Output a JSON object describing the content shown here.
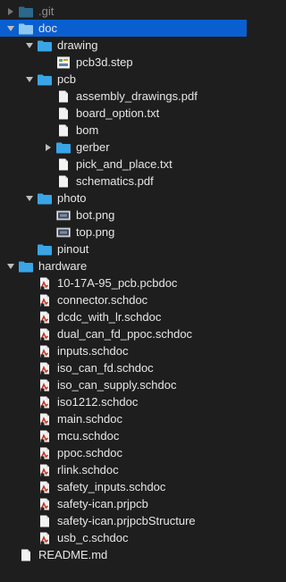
{
  "colors": {
    "background": "#1e1e1e",
    "selection": "#0a5fd0",
    "folder": "#39a5e6",
    "text": "#e6e6e6"
  },
  "tree": [
    {
      "label": ".git",
      "depth": 0,
      "kind": "folder",
      "expander": "collapsed",
      "dim": true
    },
    {
      "label": "doc",
      "depth": 0,
      "kind": "folder",
      "expander": "expanded",
      "selected": true
    },
    {
      "label": "drawing",
      "depth": 1,
      "kind": "folder",
      "expander": "expanded"
    },
    {
      "label": "pcb3d.step",
      "depth": 2,
      "kind": "file-step",
      "expander": "none"
    },
    {
      "label": "pcb",
      "depth": 1,
      "kind": "folder",
      "expander": "expanded"
    },
    {
      "label": "assembly_drawings.pdf",
      "depth": 2,
      "kind": "file-doc",
      "expander": "none"
    },
    {
      "label": "board_option.txt",
      "depth": 2,
      "kind": "file-doc",
      "expander": "none"
    },
    {
      "label": "bom",
      "depth": 2,
      "kind": "file-doc",
      "expander": "none"
    },
    {
      "label": "gerber",
      "depth": 2,
      "kind": "folder",
      "expander": "collapsed"
    },
    {
      "label": "pick_and_place.txt",
      "depth": 2,
      "kind": "file-doc",
      "expander": "none"
    },
    {
      "label": "schematics.pdf",
      "depth": 2,
      "kind": "file-doc",
      "expander": "none"
    },
    {
      "label": "photo",
      "depth": 1,
      "kind": "folder",
      "expander": "expanded"
    },
    {
      "label": "bot.png",
      "depth": 2,
      "kind": "file-image",
      "expander": "none"
    },
    {
      "label": "top.png",
      "depth": 2,
      "kind": "file-image",
      "expander": "none"
    },
    {
      "label": "pinout",
      "depth": 1,
      "kind": "folder",
      "expander": "none"
    },
    {
      "label": "hardware",
      "depth": 0,
      "kind": "folder",
      "expander": "expanded"
    },
    {
      "label": "10-17A-95_pcb.pcbdoc",
      "depth": 1,
      "kind": "file-altium",
      "expander": "none"
    },
    {
      "label": "connector.schdoc",
      "depth": 1,
      "kind": "file-altium",
      "expander": "none"
    },
    {
      "label": "dcdc_with_lr.schdoc",
      "depth": 1,
      "kind": "file-altium",
      "expander": "none"
    },
    {
      "label": "dual_can_fd_ppoc.schdoc",
      "depth": 1,
      "kind": "file-altium",
      "expander": "none"
    },
    {
      "label": "inputs.schdoc",
      "depth": 1,
      "kind": "file-altium",
      "expander": "none"
    },
    {
      "label": "iso_can_fd.schdoc",
      "depth": 1,
      "kind": "file-altium",
      "expander": "none"
    },
    {
      "label": "iso_can_supply.schdoc",
      "depth": 1,
      "kind": "file-altium",
      "expander": "none"
    },
    {
      "label": "iso1212.schdoc",
      "depth": 1,
      "kind": "file-altium",
      "expander": "none"
    },
    {
      "label": "main.schdoc",
      "depth": 1,
      "kind": "file-altium",
      "expander": "none"
    },
    {
      "label": "mcu.schdoc",
      "depth": 1,
      "kind": "file-altium",
      "expander": "none"
    },
    {
      "label": "ppoc.schdoc",
      "depth": 1,
      "kind": "file-altium",
      "expander": "none"
    },
    {
      "label": "rlink.schdoc",
      "depth": 1,
      "kind": "file-altium",
      "expander": "none"
    },
    {
      "label": "safety_inputs.schdoc",
      "depth": 1,
      "kind": "file-altium",
      "expander": "none"
    },
    {
      "label": "safety-ican.prjpcb",
      "depth": 1,
      "kind": "file-altium",
      "expander": "none"
    },
    {
      "label": "safety-ican.prjpcbStructure",
      "depth": 1,
      "kind": "file-doc",
      "expander": "none"
    },
    {
      "label": "usb_c.schdoc",
      "depth": 1,
      "kind": "file-altium",
      "expander": "none"
    },
    {
      "label": "README.md",
      "depth": 0,
      "kind": "file-doc",
      "expander": "none"
    }
  ]
}
